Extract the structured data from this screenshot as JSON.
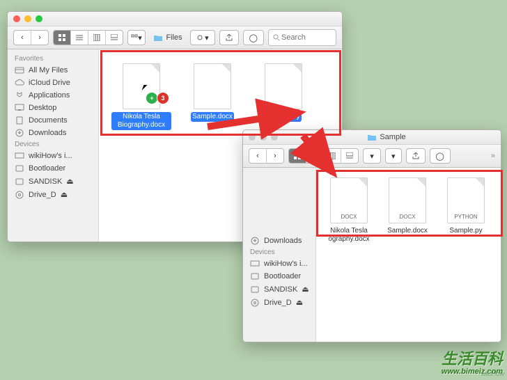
{
  "window1": {
    "title": "Files",
    "search_placeholder": "Search",
    "sidebar": {
      "sections": [
        {
          "header": "Favorites",
          "items": [
            {
              "label": "All My Files"
            },
            {
              "label": "iCloud Drive"
            },
            {
              "label": "Applications"
            },
            {
              "label": "Desktop"
            },
            {
              "label": "Documents"
            },
            {
              "label": "Downloads"
            }
          ]
        },
        {
          "header": "Devices",
          "items": [
            {
              "label": "wikiHow's i..."
            },
            {
              "label": "Bootloader"
            },
            {
              "label": "SANDISK"
            },
            {
              "label": "Drive_D"
            }
          ]
        }
      ]
    },
    "files": [
      {
        "name": "Nikola Tesla Biography.docx",
        "type": "docx",
        "selected": true
      },
      {
        "name": "Sample.docx",
        "type": "docx",
        "selected": true
      },
      {
        "name": "Sample.py",
        "type": "py",
        "selected": true
      }
    ],
    "drag_badge_count": "3"
  },
  "window2": {
    "title": "Sample",
    "sidebar": {
      "sections": [
        {
          "header": "",
          "items": [
            {
              "label": "Downloads"
            }
          ]
        },
        {
          "header": "Devices",
          "items": [
            {
              "label": "wikiHow's i..."
            },
            {
              "label": "Bootloader"
            },
            {
              "label": "SANDISK"
            },
            {
              "label": "Drive_D"
            }
          ]
        }
      ]
    },
    "files": [
      {
        "name": "Nikola Tesla ography.docx",
        "type": "DOCX",
        "selected": false
      },
      {
        "name": "Sample.docx",
        "type": "DOCX",
        "selected": false
      },
      {
        "name": "Sample.py",
        "type": "PYTHON",
        "selected": false
      }
    ]
  },
  "watermark": {
    "cn": "生活百科",
    "url": "www.bimeiz.com"
  },
  "wikihow_mark": "wikiHow"
}
